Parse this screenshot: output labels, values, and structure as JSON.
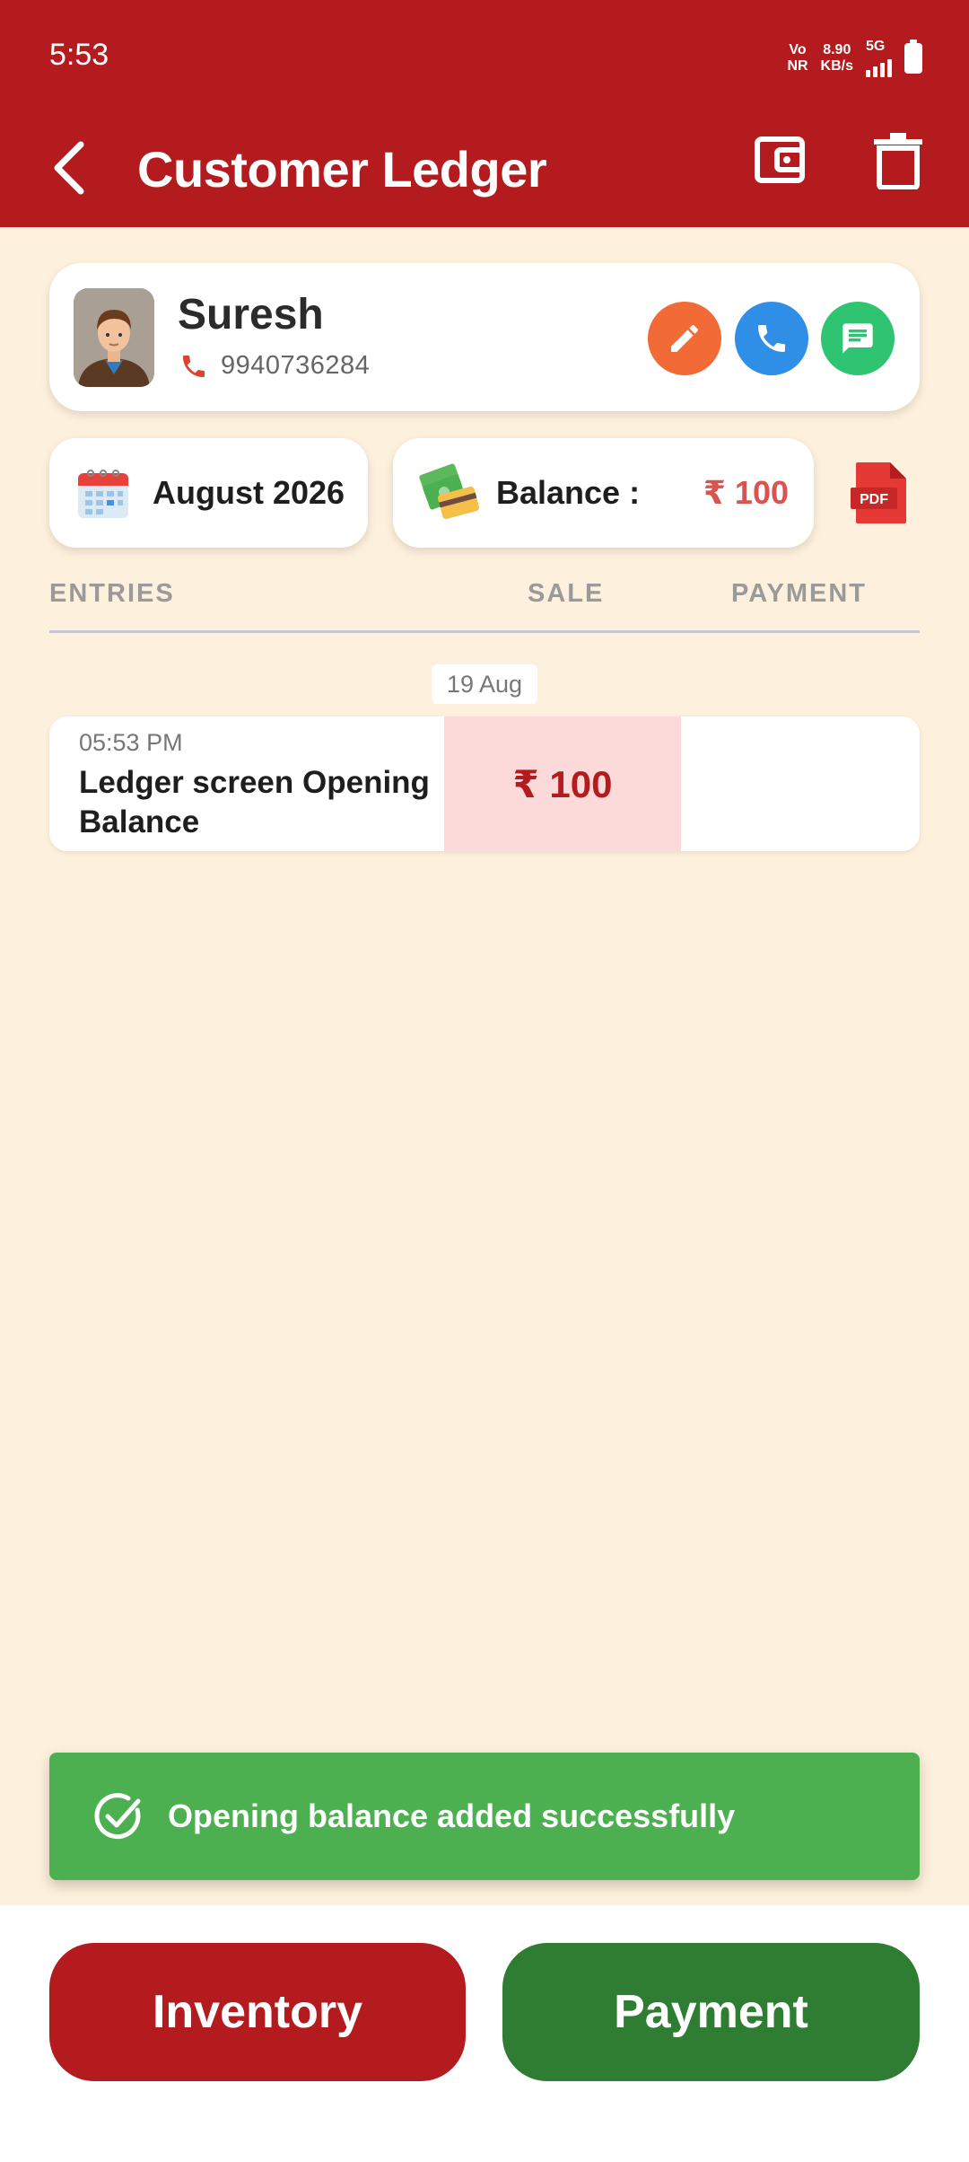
{
  "status_bar": {
    "time": "5:53",
    "volte_top": "Vo",
    "volte_bottom": "NR",
    "speed_value": "8.90",
    "speed_unit": "KB/s",
    "network": "5G",
    "icons": [
      "signal-icon",
      "battery-icon"
    ]
  },
  "app_bar": {
    "title": "Customer Ledger",
    "icons": [
      "back-arrow-icon",
      "wallet-icon",
      "trash-icon"
    ],
    "color": "#B31B1F"
  },
  "customer": {
    "name": "Suresh",
    "phone": "9940736284",
    "actions": [
      "pencil-icon",
      "phone-icon",
      "message-icon"
    ],
    "action_colors": [
      "#F26A35",
      "#2F8FE6",
      "#2FC471"
    ]
  },
  "filters": {
    "month": "August 2026",
    "balance_label": "Balance :",
    "balance_value": "₹ 100",
    "pdf_label": "PDF"
  },
  "columns": {
    "entries": "ENTRIES",
    "sale": "SALE",
    "payment": "PAYMENT"
  },
  "ledger": {
    "date": "19 Aug",
    "entries": [
      {
        "time": "05:53 PM",
        "description": "Ledger screen Opening Balance",
        "sale": "₹ 100",
        "payment": ""
      }
    ]
  },
  "toast": {
    "message": "Opening balance added successfully",
    "color": "#4CAF50"
  },
  "bottom_actions": {
    "inventory_label": "Inventory",
    "payment_label": "Payment",
    "inventory_color": "#B31B1F",
    "payment_color": "#2E7D32"
  }
}
